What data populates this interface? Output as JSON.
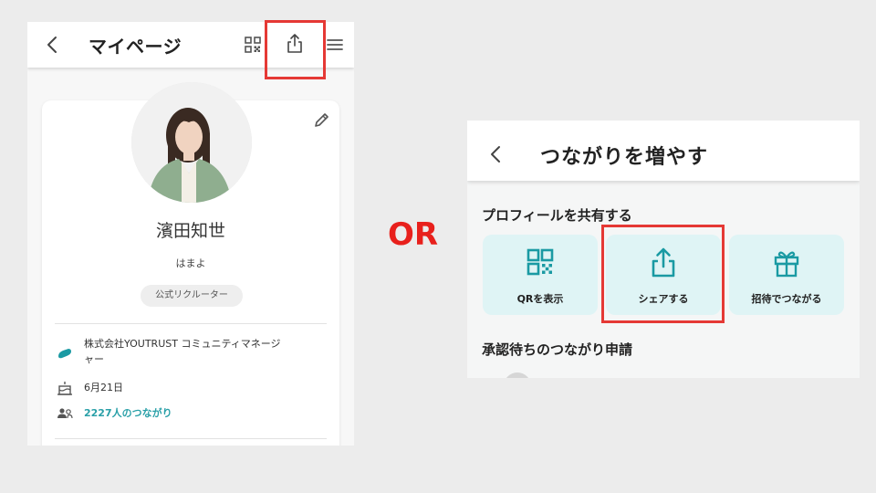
{
  "left": {
    "title": "マイページ",
    "profile": {
      "name": "濱田知世",
      "nickname": "はまよ",
      "badge": "公式リクルーター"
    },
    "info": {
      "company": "株式会社YOUTRUST コミュニティマネージャー",
      "company_line1": "株式会社YOUTRUST コミュニティマネージ",
      "company_line2": "ャー",
      "birthday": "6月21日",
      "connections": "2227人のつながり"
    }
  },
  "separator": "OR",
  "right": {
    "title": "つながりを増やす",
    "share_section": "プロフィールを共有する",
    "tiles": [
      {
        "label": "QRを表示",
        "icon": "qr-code-icon"
      },
      {
        "label": "シェアする",
        "icon": "share-icon"
      },
      {
        "label": "招待でつながる",
        "icon": "gift-icon"
      }
    ],
    "pending_section": "承認待ちのつながり申請"
  },
  "colors": {
    "highlight": "#e53935",
    "teal": "#2aa0a8",
    "tile_bg": "#dff4f5",
    "or_text": "#e8201c"
  }
}
